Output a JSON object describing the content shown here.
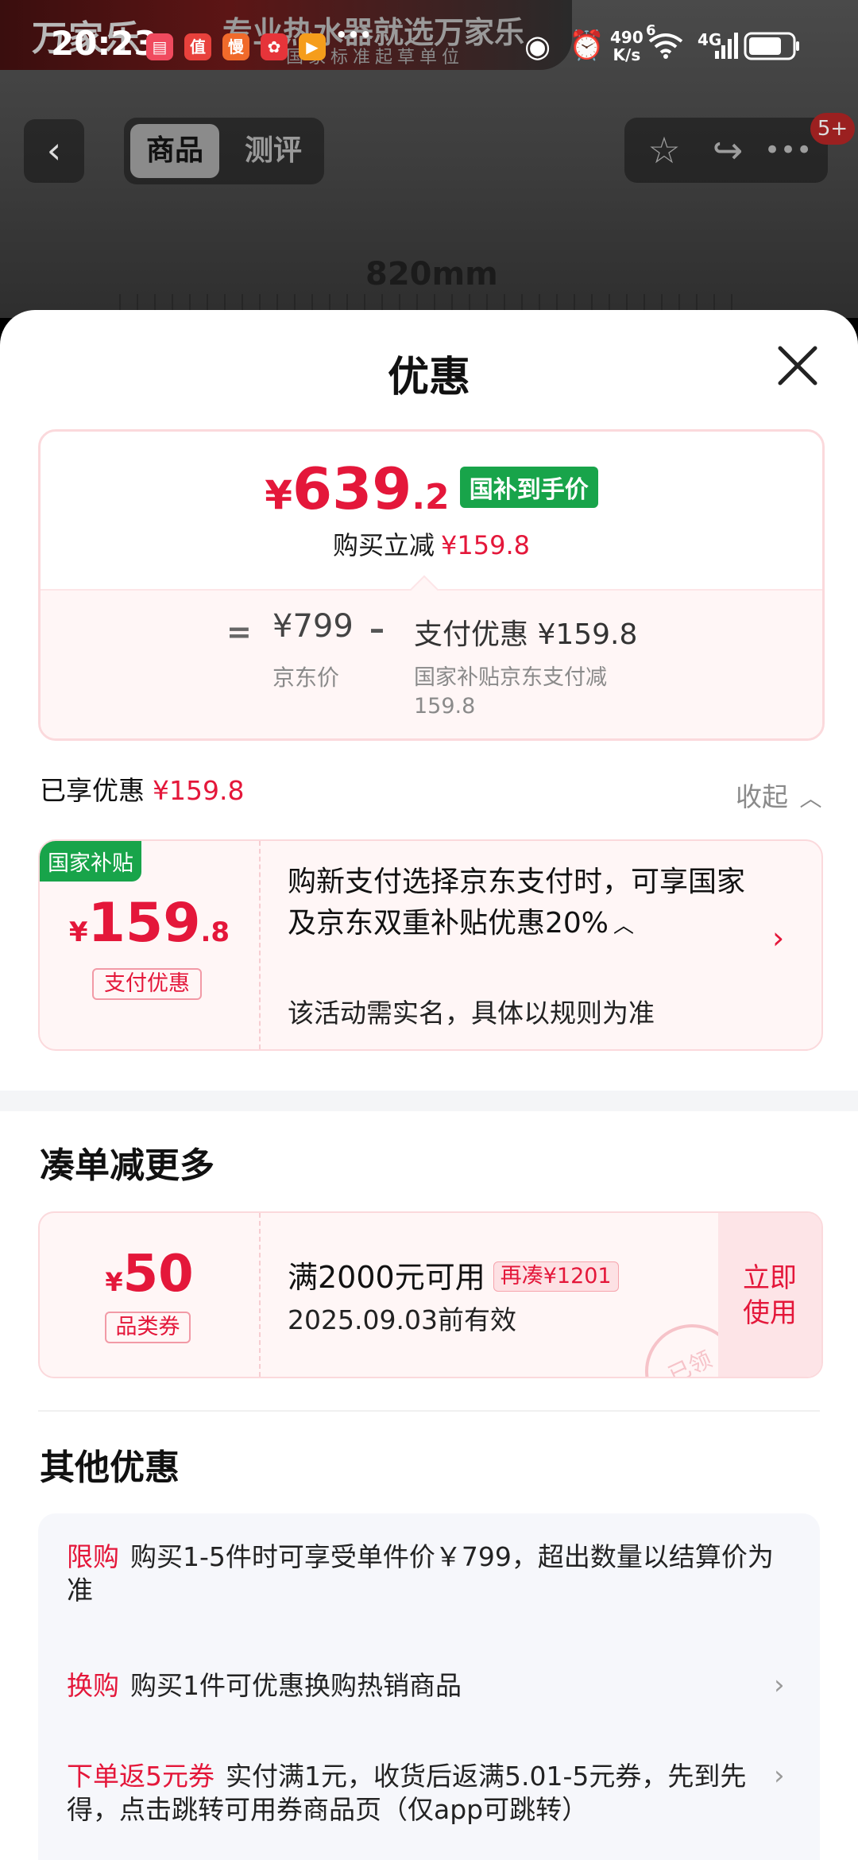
{
  "status_bar": {
    "time": "20:23",
    "net_speed": "490\nK/s",
    "signal": "4G",
    "wifi_num": "6"
  },
  "background": {
    "banner_logo": "万家乐",
    "banner_title": "专业热水器就选万家乐",
    "banner_sub": "国家标准起草单位",
    "dimension": "820mm"
  },
  "nav": {
    "tab_goods": "商品",
    "tab_review": "测评",
    "badge": "5+"
  },
  "sheet": {
    "title": "优惠"
  },
  "summary": {
    "yen": "¥",
    "price_int": "639",
    "price_dec": ".2",
    "price_tag": "国补到手价",
    "reduce_label": "购买立减",
    "reduce_amount": "¥159.8",
    "eq": "=",
    "jd_price": "¥799",
    "jd_label": "京东价",
    "minus": "–",
    "pay_label": "支付优惠 ¥159.8",
    "pay_desc": "国家补贴京东支付减159.8"
  },
  "enjoyed": {
    "label": "已享优惠",
    "amount": "¥159.8",
    "collapse": "收起"
  },
  "subsidy": {
    "tag": "国家补贴",
    "yen": "¥",
    "int": "159",
    "dec": ".8",
    "label": "支付优惠",
    "desc": "购新支付选择京东支付时，可享国家及京东双重补贴优惠20%",
    "note": "该活动需实名，具体以规则为准"
  },
  "more": {
    "title": "凑单减更多",
    "coupon": {
      "yen": "¥",
      "value": "50",
      "label": "品类券",
      "condition": "满2000元可用",
      "extra": "再凑¥1201",
      "date": "2025.09.03前有效",
      "button": "立即\n使用",
      "stamp": "已领"
    }
  },
  "other": {
    "title": "其他优惠",
    "items": [
      {
        "tag": "限购",
        "text": "购买1-5件时可享受单件价￥799，超出数量以结算价为准"
      },
      {
        "tag": "换购",
        "text": "购买1件可优惠换购热销商品"
      },
      {
        "tag": "下单返5元券",
        "text": "实付满1元，收货后返满5.01-5元券，先到先得，点击跳转可用券商品页（仅app可跳转）"
      }
    ]
  },
  "colors": {
    "accent_red": "#e4173a",
    "subsidy_green": "#18a44a"
  }
}
